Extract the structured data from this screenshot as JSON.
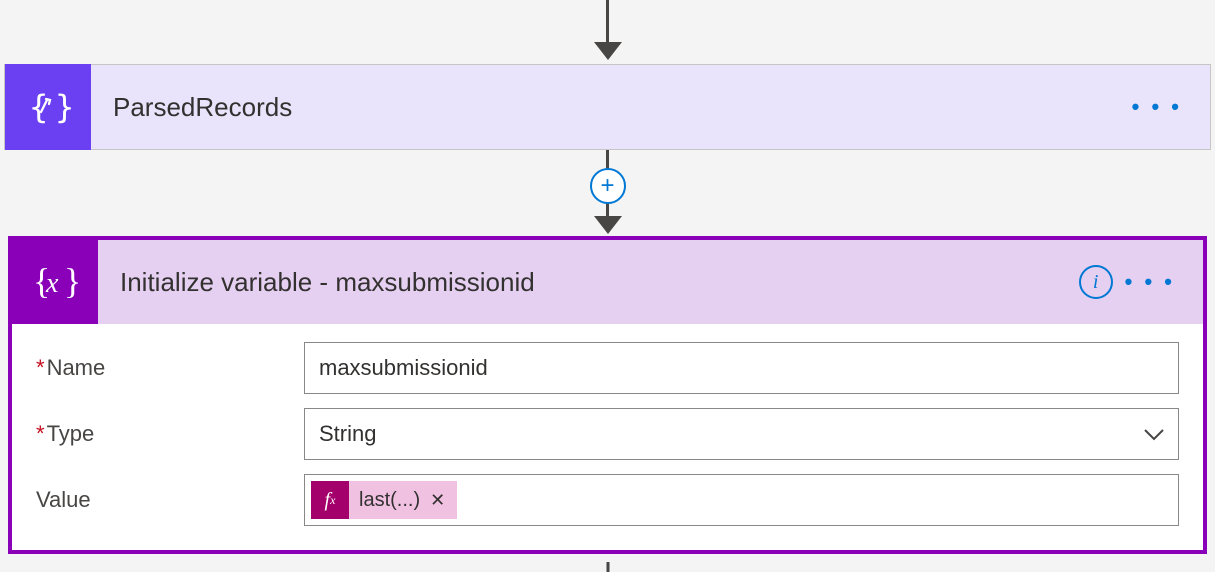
{
  "card1": {
    "title": "ParsedRecords"
  },
  "card2": {
    "title": "Initialize variable - maxsubmissionid",
    "fields": {
      "name": {
        "label": "Name",
        "value": "maxsubmissionid"
      },
      "type": {
        "label": "Type",
        "value": "String"
      },
      "value": {
        "label": "Value",
        "token": "last(...)"
      }
    }
  },
  "icons": {
    "ellipsis": "• • •",
    "info": "i",
    "plus": "+",
    "fx": "f",
    "fx_sub": "x",
    "remove": "✕"
  }
}
